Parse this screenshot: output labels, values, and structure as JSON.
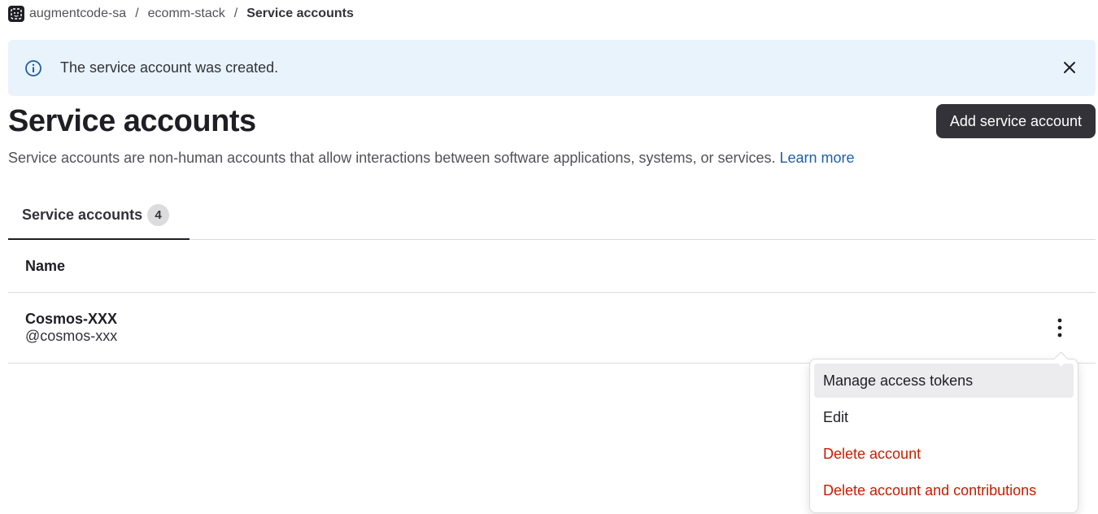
{
  "breadcrumb": {
    "group": "augmentcode-sa",
    "project": "ecomm-stack",
    "current": "Service accounts",
    "separator": "/"
  },
  "alert": {
    "message": "The service account was created.",
    "icon": "info-icon",
    "close_icon": "close-icon"
  },
  "header": {
    "title": "Service accounts",
    "add_button_label": "Add service account"
  },
  "description": {
    "text": "Service accounts are non-human accounts that allow interactions between software applications, systems, or services.",
    "link_label": "Learn more"
  },
  "tabs": [
    {
      "label": "Service accounts",
      "count": "4"
    }
  ],
  "table": {
    "columns": [
      "Name"
    ],
    "rows": [
      {
        "name": "Cosmos-XXX",
        "handle": "@cosmos-xxx"
      }
    ]
  },
  "dropdown": {
    "items": [
      {
        "label": "Manage access tokens"
      },
      {
        "label": "Edit"
      },
      {
        "label": "Delete account"
      },
      {
        "label": "Delete account and contributions"
      }
    ]
  },
  "colors": {
    "alert_bg": "#e9f3fc",
    "button_bg": "#333238",
    "link": "#1f5ea8",
    "danger": "#c91c00"
  }
}
